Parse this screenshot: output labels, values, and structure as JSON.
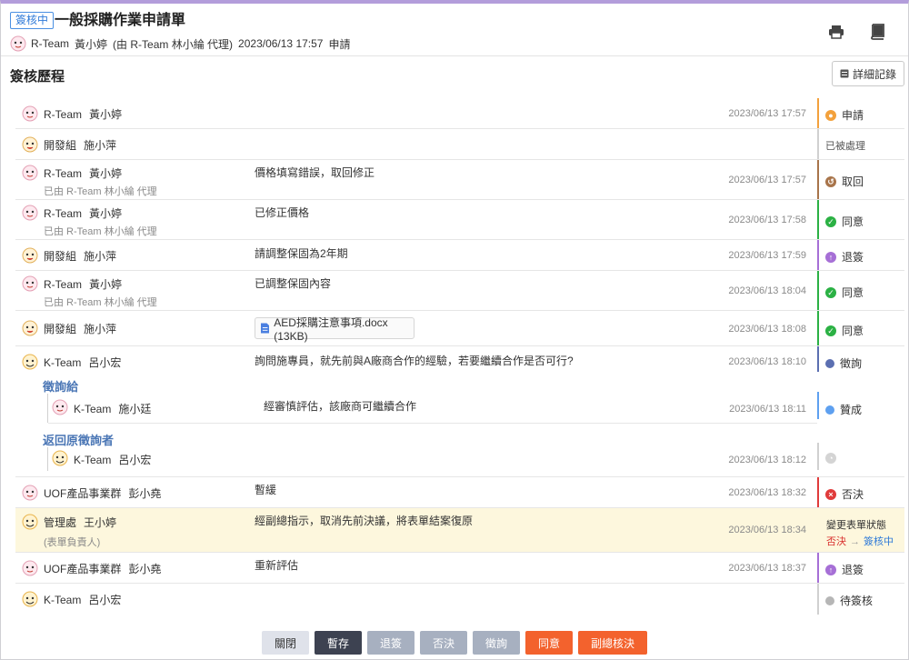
{
  "header": {
    "status": "簽核中",
    "title": "一般採購作業申請單",
    "applicant_team": "R-Team",
    "applicant_user": "黃小婷",
    "proxy_text": "(由 R-Team 林小綸 代理)",
    "applied_at": "2023/06/13 17:57",
    "action": "申請"
  },
  "section_title": "簽核歷程",
  "detail_button": "詳細記錄",
  "colors": {
    "accent": "#b39ddb",
    "apply": "#f3a13c",
    "recall": "#a8744a",
    "agree": "#2bb144",
    "return": "#a66fd6",
    "consult": "#5b6fb1",
    "approve": "#5ea0f0",
    "reject": "#e03b3b",
    "pending": "#b6b6b6",
    "primary_orange": "#f3622d"
  },
  "history": [
    {
      "team": "R-Team",
      "user": "黃小婷",
      "proxy": "",
      "comment": "",
      "time": "2023/06/13 17:57",
      "action": "申請",
      "icon": "user-icon"
    },
    {
      "team": "開發組",
      "user": "施小萍",
      "proxy": "",
      "comment": "",
      "time": "",
      "action": "已被處理",
      "icon": ""
    },
    {
      "team": "R-Team",
      "user": "黃小婷",
      "proxy": "已由 R-Team 林小綸 代理",
      "comment": "價格填寫錯誤，取回修正",
      "time": "2023/06/13 17:57",
      "action": "取回",
      "icon": "recall-icon"
    },
    {
      "team": "R-Team",
      "user": "黃小婷",
      "proxy": "已由 R-Team 林小綸 代理",
      "comment": "已修正價格",
      "time": "2023/06/13 17:58",
      "action": "同意",
      "icon": "check-icon"
    },
    {
      "team": "開發組",
      "user": "施小萍",
      "proxy": "",
      "comment": "請調整保固為2年期",
      "time": "2023/06/13 17:59",
      "action": "退簽",
      "icon": "arrow-up-icon"
    },
    {
      "team": "R-Team",
      "user": "黃小婷",
      "proxy": "已由 R-Team 林小綸 代理",
      "comment": "已調整保固內容",
      "time": "2023/06/13 18:04",
      "action": "同意",
      "icon": "check-icon"
    },
    {
      "team": "開發組",
      "user": "施小萍",
      "proxy": "",
      "attachment": "AED採購注意事項.docx (13KB)",
      "time": "2023/06/13 18:08",
      "action": "同意",
      "icon": "check-icon"
    },
    {
      "team": "K-Team",
      "user": "呂小宏",
      "proxy": "",
      "comment": "詢問施專員，就先前與A廠商合作的經驗，若要繼續合作是否可行?",
      "time": "2023/06/13 18:10",
      "action": "徵詢",
      "icon": "dot-icon"
    },
    {
      "team": "UOF產品事業群",
      "user": "彭小堯",
      "proxy": "",
      "comment": "暫緩",
      "time": "2023/06/13 18:32",
      "action": "否決",
      "icon": "x-icon"
    },
    {
      "team": "管理處",
      "user": "王小婷",
      "proxy": "(表單負責人)",
      "comment": "經副總指示，取消先前決議，將表單結案復原",
      "time": "2023/06/13 18:34",
      "action_label": "變更表單狀態",
      "from": "否決",
      "to": "簽核中"
    },
    {
      "team": "UOF產品事業群",
      "user": "彭小堯",
      "proxy": "",
      "comment": "重新評估",
      "time": "2023/06/13 18:37",
      "action": "退簽",
      "icon": "arrow-up-icon"
    },
    {
      "team": "K-Team",
      "user": "呂小宏",
      "proxy": "",
      "comment": "",
      "time": "",
      "action": "待簽核",
      "icon": "dot-icon"
    }
  ],
  "consult": {
    "to_label": "徵詢給",
    "to_team": "K-Team",
    "to_user": "施小廷",
    "to_comment": "經審慎評估，該廠商可繼續合作",
    "to_time": "2023/06/13 18:11",
    "to_action": "贊成",
    "back_label": "返回原徵詢者",
    "back_team": "K-Team",
    "back_user": "呂小宏",
    "back_time": "2023/06/13 18:12"
  },
  "footer": {
    "close": "關閉",
    "save": "暫存",
    "return": "退簽",
    "reject": "否決",
    "consult": "徵詢",
    "agree": "同意",
    "vp_decide": "副總核決"
  }
}
